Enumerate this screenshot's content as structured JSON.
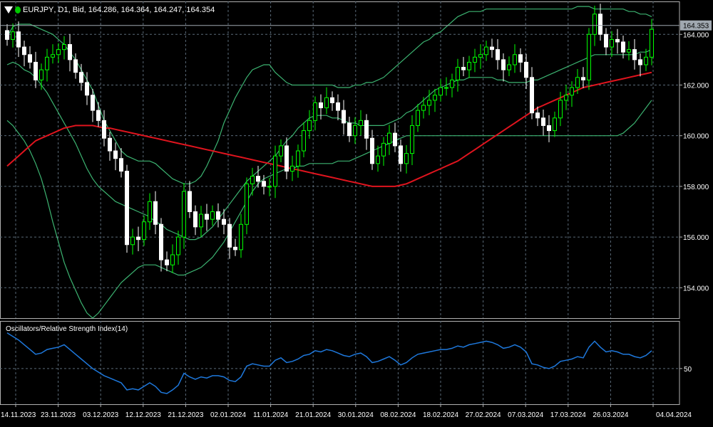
{
  "header": {
    "symbol": "EURJPY",
    "timeframe": "D1",
    "price_type": "Bid",
    "open": "164.286",
    "high": "164.364",
    "low": "164.247",
    "close": "164.354",
    "menu_icon": "triangle-down-icon",
    "status_icon": "green-dot-icon"
  },
  "rsi_panel": {
    "title": "Oscillators/Relative Strength Index(14)"
  },
  "colors": {
    "background": "#000000",
    "grid": "#5a6a78",
    "candle_bull": "#00ff00",
    "candle_bear": "#ffffff",
    "bollinger": "#3cb371",
    "moving_average": "#e0141e",
    "rsi_line": "#1e78dc",
    "price_line": "#a0a8b0"
  },
  "chart_data": [
    {
      "type": "candlestick",
      "symbol": "EURJPY",
      "timeframe": "D1",
      "current_price": "164.353",
      "price_axis": [
        "164.000",
        "162.000",
        "160.000",
        "158.000",
        "156.000",
        "154.000"
      ],
      "ylim": [
        152.8,
        165.3
      ],
      "date_labels": [
        "14.11.2023",
        "23.11.2023",
        "03.12.2023",
        "12.12.2023",
        "21.12.2023",
        "02.01.2024",
        "11.01.2024",
        "21.01.2024",
        "30.01.2024",
        "08.02.2024",
        "18.02.2024",
        "27.02.2024",
        "07.03.2024",
        "17.03.2024",
        "26.03.2024",
        "04.04.2024"
      ],
      "grid": true,
      "closes": [
        163.8,
        164.1,
        163.5,
        163.2,
        162.9,
        162.2,
        162.6,
        163.1,
        163.2,
        163.4,
        163.6,
        163.0,
        162.5,
        162.1,
        161.6,
        161.0,
        160.6,
        159.9,
        159.4,
        159.1,
        158.6,
        155.7,
        156.0,
        155.9,
        156.6,
        157.4,
        156.5,
        155.1,
        154.9,
        155.3,
        156.0,
        157.8,
        157.0,
        156.4,
        156.9,
        156.7,
        157.0,
        156.7,
        156.5,
        155.6,
        155.5,
        156.5,
        158.1,
        158.4,
        158.2,
        158.0,
        158.0,
        159.2,
        159.6,
        158.6,
        158.8,
        159.4,
        160.2,
        160.6,
        161.3,
        161.1,
        161.5,
        161.3,
        161.0,
        160.5,
        160.0,
        160.4,
        160.6,
        159.9,
        158.9,
        159.2,
        159.7,
        160.1,
        159.6,
        158.9,
        159.3,
        160.4,
        161.0,
        161.2,
        161.4,
        161.6,
        161.9,
        161.9,
        162.2,
        162.7,
        162.6,
        162.9,
        163.1,
        163.2,
        163.5,
        163.4,
        163.0,
        162.6,
        162.8,
        163.2,
        162.9,
        162.3,
        160.9,
        160.7,
        160.4,
        160.2,
        160.7,
        161.4,
        161.6,
        161.9,
        162.3,
        162.2,
        164.0,
        164.8,
        164.0,
        163.5,
        163.8,
        163.7,
        163.3,
        163.4,
        163.0,
        162.8,
        163.1,
        164.2
      ],
      "bollinger_upper": [
        163.9,
        164.3,
        164.4,
        164.4,
        164.4,
        164.3,
        164.2,
        164.1,
        164.0,
        163.8,
        163.6,
        163.3,
        163.0,
        162.6,
        162.2,
        161.8,
        161.2,
        160.6,
        160.2,
        159.8,
        159.4,
        159.2,
        159.1,
        159.0,
        159.0,
        159.0,
        158.9,
        158.7,
        158.5,
        158.3,
        158.2,
        158.1,
        158.1,
        158.2,
        158.4,
        158.8,
        159.3,
        159.8,
        160.5,
        161.0,
        161.5,
        161.9,
        162.3,
        162.6,
        162.7,
        162.8,
        162.8,
        162.5,
        162.3,
        162.1,
        162.0,
        162.0,
        162.0,
        162.0,
        162.0,
        162.0,
        162.0,
        162.0,
        161.9,
        161.9,
        161.9,
        162.0,
        162.0,
        162.1,
        162.1,
        162.2,
        162.3,
        162.5,
        162.7,
        162.9,
        163.1,
        163.3,
        163.5,
        163.7,
        163.8,
        164.0,
        164.1,
        164.3,
        164.5,
        164.7,
        164.8,
        164.9,
        164.9,
        164.9,
        165.0,
        165.0,
        165.0,
        165.0,
        165.0,
        165.0,
        165.0,
        165.0,
        165.0,
        165.0,
        165.0,
        165.0,
        165.0,
        165.0,
        165.0,
        165.0,
        165.1,
        165.1,
        165.1,
        165.0,
        165.0,
        165.0,
        165.0,
        165.0,
        165.0,
        164.9,
        164.9,
        164.8,
        164.8,
        164.7
      ],
      "bollinger_middle": [
        162.8,
        162.9,
        162.8,
        162.6,
        162.5,
        162.3,
        162.0,
        161.7,
        161.3,
        160.9,
        160.5,
        160.1,
        159.7,
        159.2,
        158.7,
        158.3,
        158.0,
        157.8,
        157.6,
        157.4,
        157.3,
        157.2,
        157.1,
        157.0,
        156.9,
        156.8,
        156.6,
        156.5,
        156.3,
        156.2,
        156.1,
        156.0,
        155.9,
        155.9,
        156.0,
        156.2,
        156.4,
        156.7,
        157.0,
        157.3,
        157.6,
        157.9,
        158.2,
        158.4,
        158.6,
        158.8,
        159.0,
        159.2,
        159.5,
        159.8,
        160.0,
        160.3,
        160.5,
        160.7,
        160.8,
        160.8,
        160.8,
        160.7,
        160.7,
        160.6,
        160.5,
        160.5,
        160.4,
        160.4,
        160.4,
        160.4,
        160.4,
        160.5,
        160.6,
        160.7,
        160.9,
        161.0,
        161.2,
        161.4,
        161.6,
        161.8,
        161.9,
        162.0,
        162.1,
        162.2,
        162.2,
        162.3,
        162.3,
        162.3,
        162.3,
        162.3,
        162.2,
        162.2,
        162.1,
        162.1,
        162.1,
        162.1,
        162.2,
        162.2,
        162.3,
        162.4,
        162.5,
        162.6,
        162.7,
        162.8,
        162.9,
        163.0,
        163.1,
        163.2,
        163.2,
        163.2,
        163.2,
        163.2,
        163.2,
        163.2,
        163.2,
        163.3,
        163.3,
        163.4
      ],
      "bollinger_lower": [
        160.6,
        160.4,
        160.1,
        159.8,
        159.4,
        158.9,
        158.3,
        157.5,
        156.6,
        155.8,
        155.0,
        154.4,
        153.9,
        153.4,
        153.0,
        152.8,
        153.0,
        153.3,
        153.6,
        153.9,
        154.2,
        154.4,
        154.6,
        154.8,
        154.9,
        154.9,
        154.9,
        154.8,
        154.7,
        154.6,
        154.5,
        154.5,
        154.6,
        154.7,
        154.8,
        155.0,
        155.2,
        155.5,
        155.8,
        156.2,
        156.6,
        157.0,
        157.4,
        157.8,
        158.1,
        158.3,
        158.4,
        158.5,
        158.6,
        158.7,
        158.7,
        158.8,
        158.8,
        158.9,
        158.9,
        158.9,
        158.9,
        158.9,
        159.0,
        159.0,
        159.0,
        159.1,
        159.2,
        159.3,
        159.4,
        159.5,
        159.6,
        159.7,
        159.8,
        159.9,
        160.0,
        160.0,
        160.0,
        160.0,
        160.0,
        160.0,
        160.0,
        160.0,
        160.0,
        160.0,
        160.0,
        160.0,
        160.0,
        160.0,
        160.0,
        160.0,
        160.0,
        160.0,
        160.0,
        160.0,
        160.0,
        160.0,
        160.0,
        160.0,
        160.0,
        160.0,
        160.0,
        160.0,
        160.0,
        160.0,
        160.0,
        160.0,
        160.0,
        160.0,
        160.0,
        160.0,
        160.0,
        160.0,
        160.1,
        160.3,
        160.5,
        160.8,
        161.1,
        161.4
      ],
      "moving_average": [
        158.8,
        159.0,
        159.2,
        159.4,
        159.6,
        159.8,
        159.9,
        160.0,
        160.1,
        160.2,
        160.3,
        160.35,
        160.4,
        160.4,
        160.4,
        160.4,
        160.35,
        160.3,
        160.3,
        160.25,
        160.2,
        160.15,
        160.1,
        160.05,
        160.0,
        159.95,
        159.9,
        159.85,
        159.8,
        159.75,
        159.7,
        159.65,
        159.6,
        159.55,
        159.5,
        159.45,
        159.4,
        159.35,
        159.3,
        159.25,
        159.2,
        159.15,
        159.1,
        159.05,
        159.0,
        158.95,
        158.9,
        158.85,
        158.8,
        158.75,
        158.7,
        158.65,
        158.6,
        158.55,
        158.5,
        158.45,
        158.4,
        158.35,
        158.3,
        158.25,
        158.2,
        158.15,
        158.1,
        158.05,
        158.0,
        158.0,
        158.0,
        158.0,
        158.0,
        158.05,
        158.1,
        158.2,
        158.3,
        158.4,
        158.5,
        158.6,
        158.7,
        158.8,
        158.9,
        159.0,
        159.15,
        159.3,
        159.45,
        159.6,
        159.75,
        159.9,
        160.05,
        160.2,
        160.35,
        160.5,
        160.65,
        160.8,
        160.95,
        161.1,
        161.2,
        161.3,
        161.4,
        161.5,
        161.6,
        161.7,
        161.8,
        161.9,
        161.95,
        162.0,
        162.05,
        162.1,
        162.15,
        162.2,
        162.25,
        162.3,
        162.35,
        162.4,
        162.45,
        162.5
      ]
    },
    {
      "type": "line",
      "title": "Oscillators/Relative Strength Index(14)",
      "name": "RSI(14)",
      "level_label": "50",
      "ylim": [
        20,
        90
      ],
      "values": [
        80,
        77,
        74,
        70,
        66,
        62,
        63,
        66,
        67,
        68,
        70,
        66,
        62,
        58,
        54,
        50,
        47,
        44,
        42,
        40,
        38,
        32,
        33,
        32,
        35,
        38,
        35,
        30,
        29,
        32,
        36,
        46,
        43,
        41,
        43,
        42,
        44,
        44,
        43,
        40,
        39,
        43,
        52,
        54,
        53,
        52,
        52,
        57,
        59,
        55,
        56,
        58,
        61,
        62,
        65,
        64,
        66,
        65,
        63,
        61,
        60,
        62,
        63,
        60,
        55,
        56,
        58,
        60,
        57,
        53,
        55,
        59,
        62,
        63,
        64,
        65,
        66,
        66,
        67,
        69,
        68,
        70,
        71,
        72,
        73,
        72,
        70,
        67,
        68,
        70,
        68,
        64,
        54,
        53,
        51,
        50,
        52,
        56,
        57,
        58,
        60,
        59,
        68,
        73,
        68,
        64,
        65,
        64,
        62,
        62,
        60,
        59,
        61,
        65
      ]
    }
  ]
}
